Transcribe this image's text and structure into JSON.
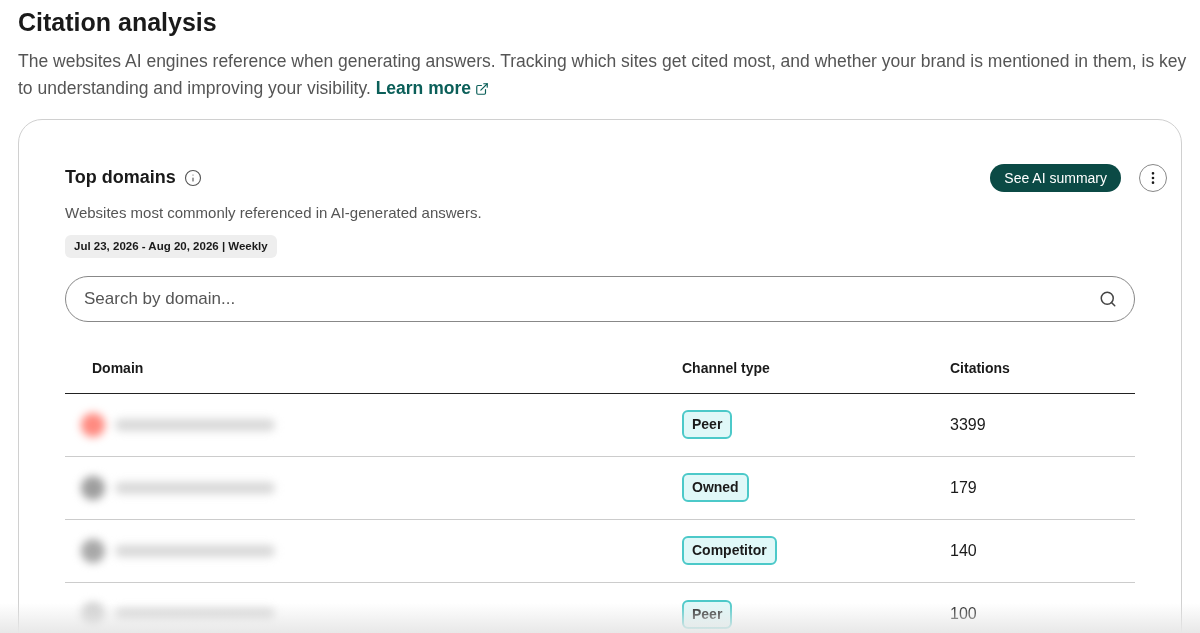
{
  "page": {
    "title": "Citation analysis",
    "description": "The websites AI engines reference when generating answers. Tracking which sites get cited most, and whether your brand is mentioned in them, is key to understanding and improving your visibility.",
    "learn_more": "Learn more"
  },
  "card": {
    "title": "Top domains",
    "subtitle": "Websites most commonly referenced in AI-generated answers.",
    "date_range": "Jul 23, 2026 - Aug 20, 2026 | Weekly",
    "summary_button": "See AI summary",
    "search": {
      "placeholder": "Search by domain..."
    },
    "table": {
      "columns": [
        "Domain",
        "Channel type",
        "Citations"
      ],
      "rows": [
        {
          "color": "#ff8a80",
          "channel_type": "Peer",
          "citations": "3399"
        },
        {
          "color": "#9e9e9e",
          "channel_type": "Owned",
          "citations": "179"
        },
        {
          "color": "#a8a8a8",
          "channel_type": "Competitor",
          "citations": "140"
        },
        {
          "color": "#d0d0d0",
          "channel_type": "Peer",
          "citations": "100"
        }
      ]
    }
  }
}
